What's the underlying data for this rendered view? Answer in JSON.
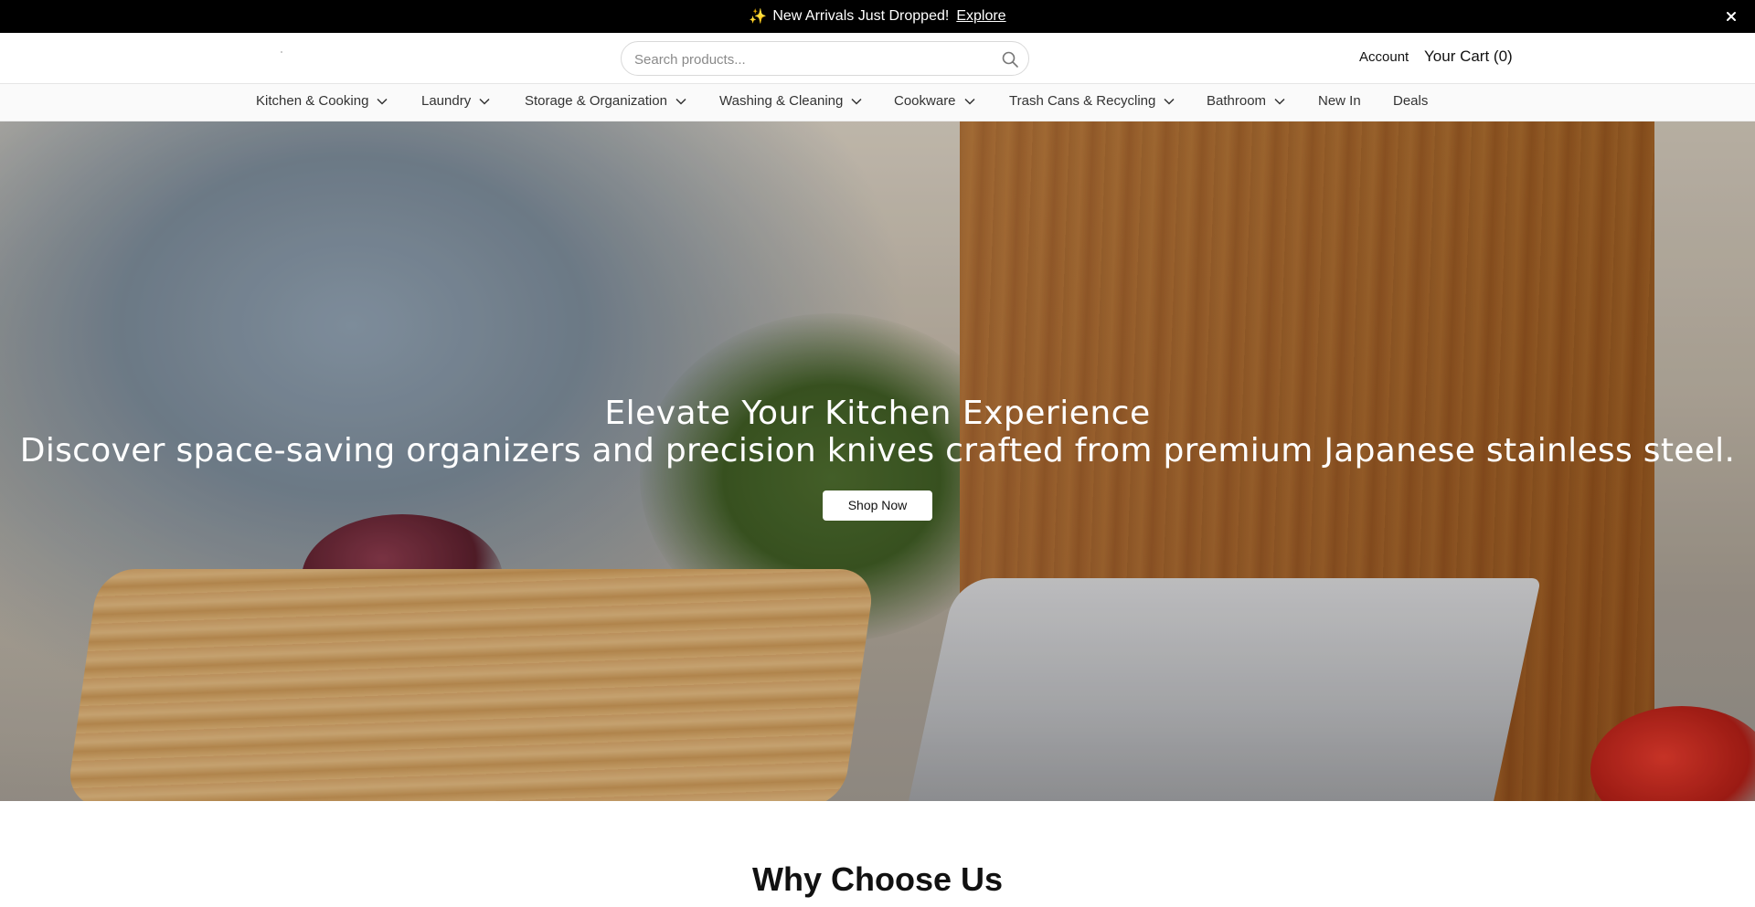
{
  "announcement": {
    "sparkle": "✨",
    "message": "New Arrivals Just Dropped!",
    "link": "Explore"
  },
  "header": {
    "search_placeholder": "Search products...",
    "account": "Account",
    "cart": "Your Cart (0)"
  },
  "nav": {
    "items": [
      {
        "label": "Kitchen & Cooking",
        "dropdown": true
      },
      {
        "label": "Laundry",
        "dropdown": true
      },
      {
        "label": "Storage & Organization",
        "dropdown": true
      },
      {
        "label": "Washing & Cleaning",
        "dropdown": true
      },
      {
        "label": "Cookware",
        "dropdown": true
      },
      {
        "label": "Trash Cans & Recycling",
        "dropdown": true
      },
      {
        "label": "Bathroom",
        "dropdown": true
      },
      {
        "label": "New In",
        "dropdown": false
      },
      {
        "label": "Deals",
        "dropdown": false
      }
    ]
  },
  "hero": {
    "title": "Elevate Your Kitchen Experience",
    "subtitle": "Discover space-saving organizers and precision knives crafted from premium Japanese stainless steel.",
    "cta": "Shop Now"
  },
  "sections": {
    "why_title": "Why Choose Us"
  },
  "colors": {
    "announcement_bg": "#000000",
    "nav_bg": "#fafafa",
    "button_bg": "#ffffff"
  }
}
